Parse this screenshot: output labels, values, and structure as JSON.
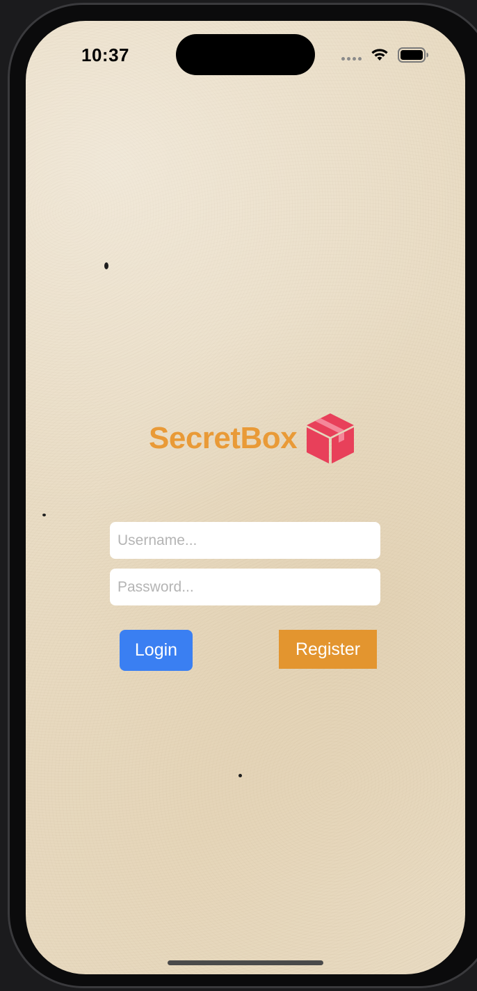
{
  "status_bar": {
    "time": "10:37",
    "signal_icon": "signal-dots-icon",
    "wifi_icon": "wifi-icon",
    "battery_icon": "battery-icon"
  },
  "logo": {
    "text": "SecretBox",
    "icon": "box-icon",
    "text_color": "#e99a37",
    "icon_color": "#e8405a"
  },
  "form": {
    "username_placeholder": "Username...",
    "username_value": "",
    "password_placeholder": "Password...",
    "password_value": ""
  },
  "actions": {
    "login_label": "Login",
    "register_label": "Register",
    "login_color": "#3a7ff2",
    "register_color": "#e3952f"
  },
  "theme": {
    "background": "#e9dcc4"
  }
}
